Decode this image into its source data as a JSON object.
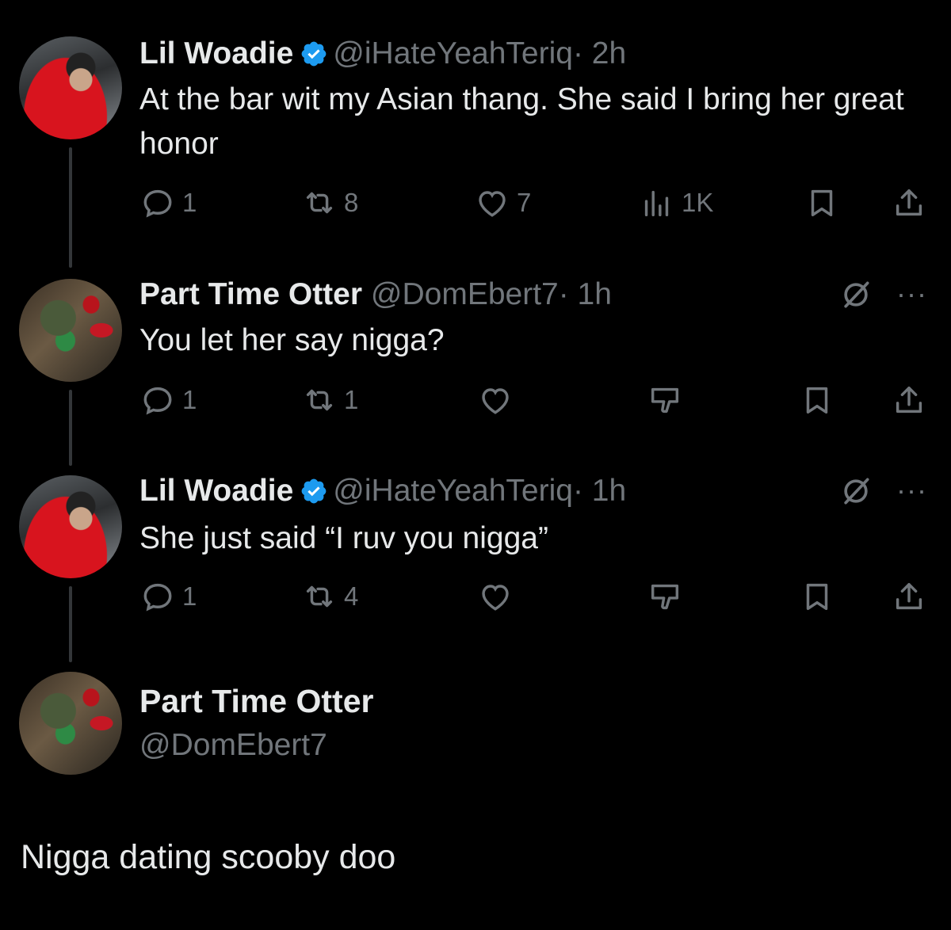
{
  "tweets": [
    {
      "name": "Lil Woadie",
      "handle": "@iHateYeahTeriq",
      "time": "· 2h",
      "verified": true,
      "text": "At the bar wit my Asian thang. She said I bring her great honor",
      "replies": "1",
      "retweets": "8",
      "likes": "7",
      "views": "1K"
    },
    {
      "name": "Part Time Otter",
      "handle": "@DomEbert7",
      "time": "· 1h",
      "verified": false,
      "text": "You let her say nigga?",
      "replies": "1",
      "retweets": "1",
      "likes": "",
      "more": "···"
    },
    {
      "name": "Lil Woadie",
      "handle": "@iHateYeahTeriq",
      "time": "· 1h",
      "verified": true,
      "text": "She just said “I ruv you nigga”",
      "replies": "1",
      "retweets": "4",
      "likes": "",
      "more": "···"
    }
  ],
  "compose": {
    "name": "Part Time Otter",
    "handle": "@DomEbert7",
    "text": "Nigga dating scooby doo"
  },
  "colors": {
    "background": "#000000",
    "text": "#e7e9ea",
    "secondary": "#71767b",
    "verified": "#1d9bf0",
    "thread_line": "#333639"
  },
  "icons": [
    "verified-badge-icon",
    "reply-icon",
    "retweet-icon",
    "like-icon",
    "views-icon",
    "dislike-icon",
    "bookmark-icon",
    "share-icon",
    "grok-icon",
    "more-icon"
  ]
}
